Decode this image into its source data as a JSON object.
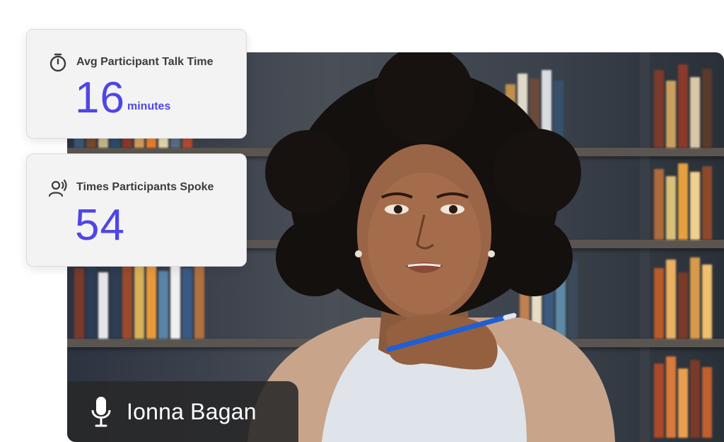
{
  "metrics": {
    "talk_time": {
      "label": "Avg Participant Talk Time",
      "value": "16",
      "unit": "minutes",
      "icon": "stopwatch-icon"
    },
    "times_spoke": {
      "label": "Times Participants Spoke",
      "value": "54",
      "icon": "speaking-person-icon"
    }
  },
  "participant": {
    "name": "Ionna Bagan",
    "icon": "microphone-icon"
  },
  "colors": {
    "accent": "#4f46e5",
    "card_bg": "#f3f3f4",
    "nametag_bg": "#282828"
  }
}
